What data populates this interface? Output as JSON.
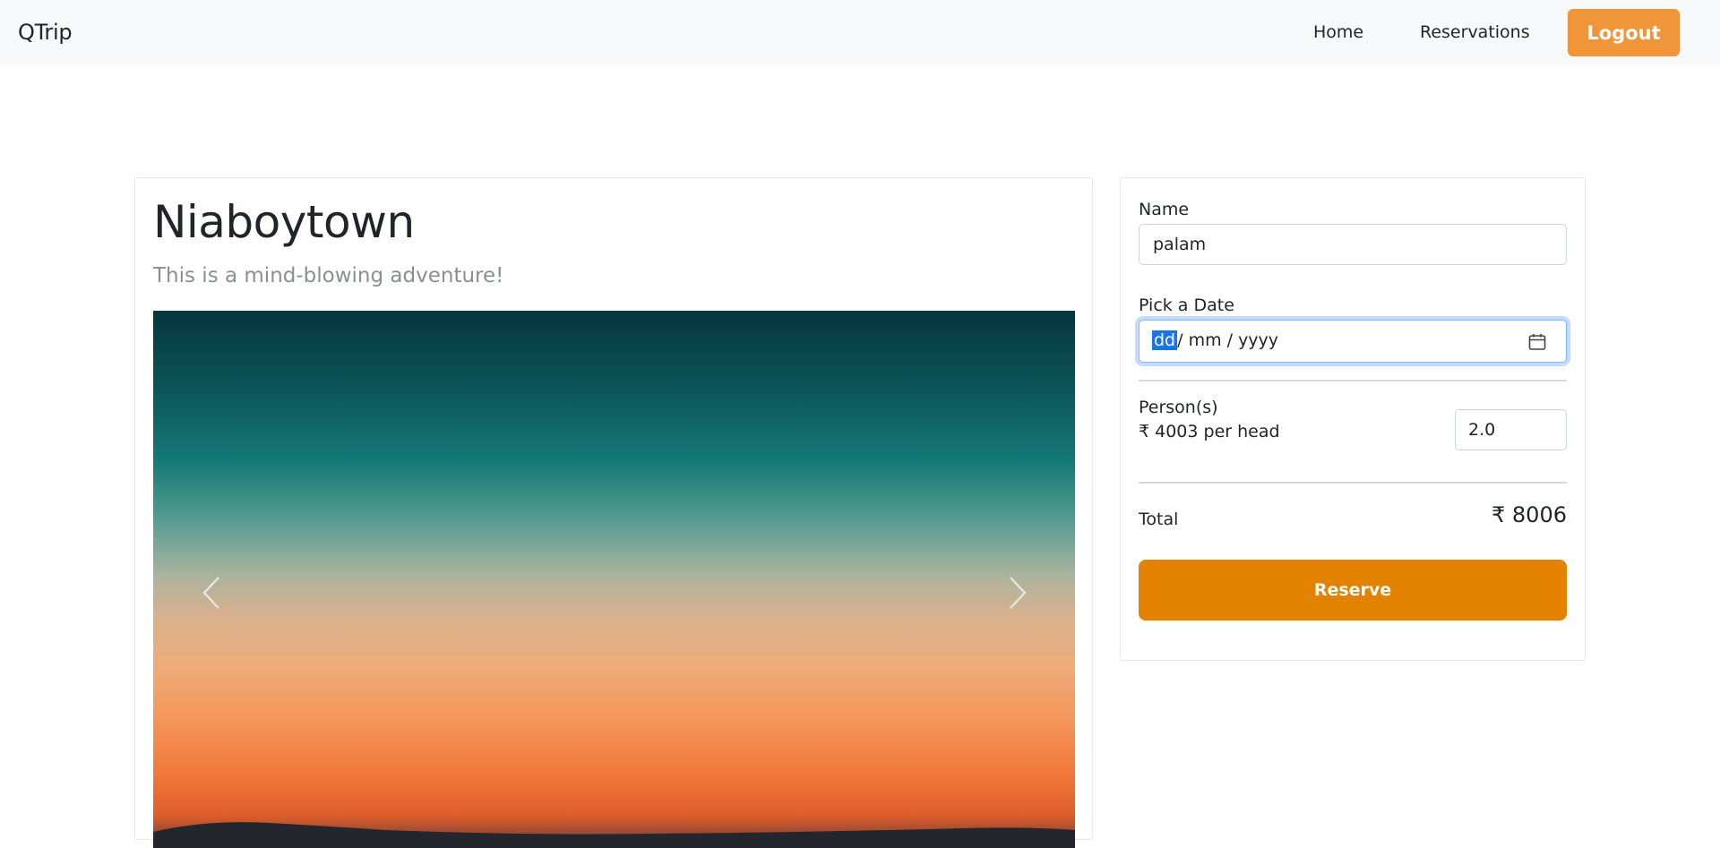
{
  "navbar": {
    "brand": "QTrip",
    "links": [
      {
        "label": "Home"
      },
      {
        "label": "Reservations"
      }
    ],
    "logout_label": "Logout"
  },
  "adventure": {
    "title": "Niaboytown",
    "subtitle": "This is a mind-blowing adventure!",
    "carousel": {
      "prev_icon": "chevron-left-icon",
      "next_icon": "chevron-right-icon"
    }
  },
  "reservation": {
    "name_label": "Name",
    "name_value": "palam",
    "date_label": "Pick a Date",
    "date_segments": {
      "day": "dd",
      "rest": "/ mm / yyyy"
    },
    "calendar_icon": "calendar-icon",
    "persons_label": "Person(s)",
    "per_head": "₹ 4003 per head",
    "persons_value": "2.0",
    "total_label": "Total",
    "total_value": "₹ 8006",
    "reserve_label": "Reserve"
  },
  "colors": {
    "logout": "#f0953a",
    "reserve": "#e38100",
    "navbar_bg": "#f8f9fa",
    "focus_ring": "#86b7fe"
  }
}
